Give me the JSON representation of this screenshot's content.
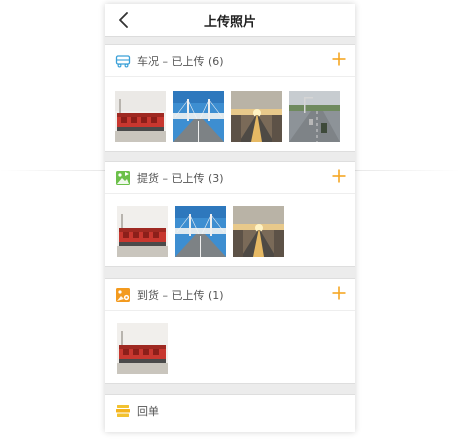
{
  "header": {
    "title": "上传照片"
  },
  "sections": [
    {
      "title": "车况",
      "status": "已上传",
      "count": "(6)",
      "icon": "truck-icon",
      "thumbnails": [
        "trucks-photo",
        "bridge-photo",
        "sunset-road-photo",
        "highway-photo"
      ]
    },
    {
      "title": "提货",
      "status": "已上传",
      "count": "(3)",
      "icon": "image-flag-icon",
      "thumbnails": [
        "trucks-photo",
        "bridge-photo",
        "sunset-road-photo"
      ]
    },
    {
      "title": "到货",
      "status": "已上传",
      "count": "(1)",
      "icon": "image-pin-icon",
      "thumbnails": [
        "trucks-photo"
      ]
    }
  ],
  "receipt": {
    "label": "回单",
    "icon": "receipt-icon"
  },
  "colors": {
    "accent": "#f5a623",
    "truck_icon": "#3aa0d8",
    "pickup_icon": "#6cc04a",
    "arrive_icon": "#f39a1e",
    "receipt_icon": "#f2c230"
  }
}
